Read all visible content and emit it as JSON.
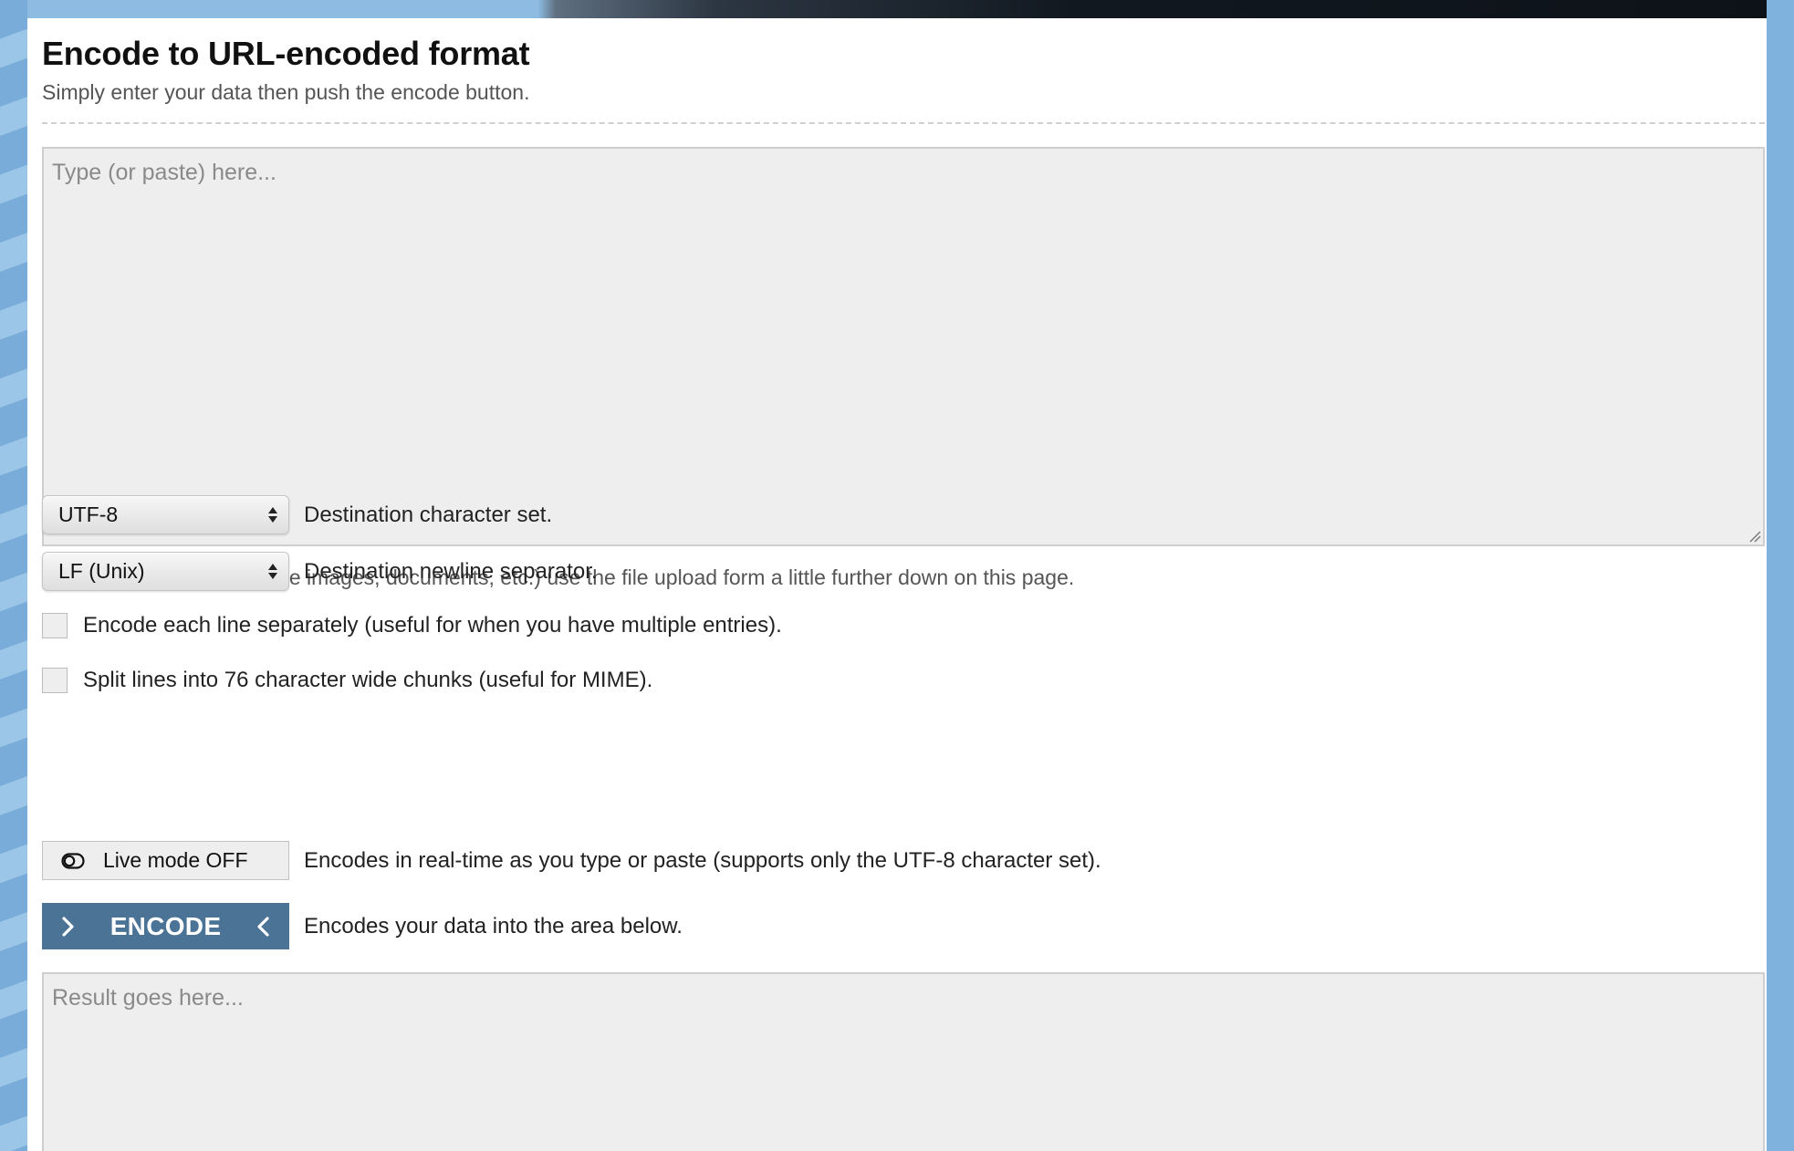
{
  "page": {
    "title": "Encode to URL-encoded format",
    "subtitle": "Simply enter your data then push the encode button."
  },
  "input": {
    "placeholder": "Type (or paste) here...",
    "value": ""
  },
  "info": {
    "icon": "info-icon",
    "text": "To encode binaries (like images, documents, etc.) use the file upload form a little further down on this page."
  },
  "options": {
    "charset": {
      "selected": "UTF-8",
      "label": "Destination character set."
    },
    "newline": {
      "selected": "LF (Unix)",
      "label": "Destination newline separator."
    },
    "encode_each_line": {
      "checked": false,
      "label": "Encode each line separately (useful for when you have multiple entries)."
    },
    "split_lines": {
      "checked": false,
      "label": "Split lines into 76 character wide chunks (useful for MIME)."
    },
    "live_mode": {
      "button_label": "Live mode OFF",
      "icon": "toggle-off-icon",
      "label": "Encodes in real-time as you type or paste (supports only the UTF-8 character set)."
    }
  },
  "encode": {
    "button_label": "ENCODE",
    "label": "Encodes your data into the area below."
  },
  "result": {
    "placeholder": "Result goes here...",
    "value": ""
  },
  "colors": {
    "accent": "#4b7396",
    "field_bg": "#eeeeee",
    "page_bg": "#7fb2dd"
  }
}
